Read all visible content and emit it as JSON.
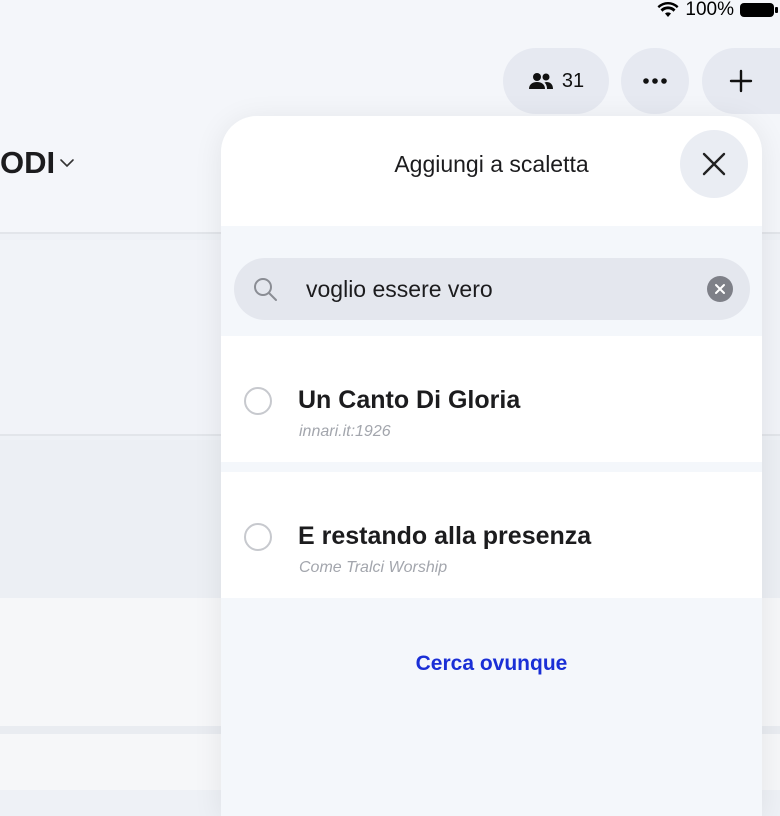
{
  "status_bar": {
    "battery": "100%"
  },
  "header": {
    "people_count": "31",
    "title": "ODI"
  },
  "sheet": {
    "title": "Aggiungi a scaletta",
    "search": {
      "value": "voglio essere vero"
    },
    "results": [
      {
        "title": "Un Canto Di Gloria",
        "subtitle": "innari.it:1926"
      },
      {
        "title": "E restando alla presenza",
        "subtitle": "Come Tralci Worship"
      }
    ],
    "search_everywhere": "Cerca ovunque"
  },
  "colors": {
    "accent": "#1a2fd6",
    "sheet_bg": "#f4f7fb"
  },
  "icons": [
    "wifi-icon",
    "battery-icon",
    "people-icon",
    "more-icon",
    "plus-icon",
    "chevron-down-icon",
    "close-icon",
    "search-icon",
    "clear-icon"
  ]
}
